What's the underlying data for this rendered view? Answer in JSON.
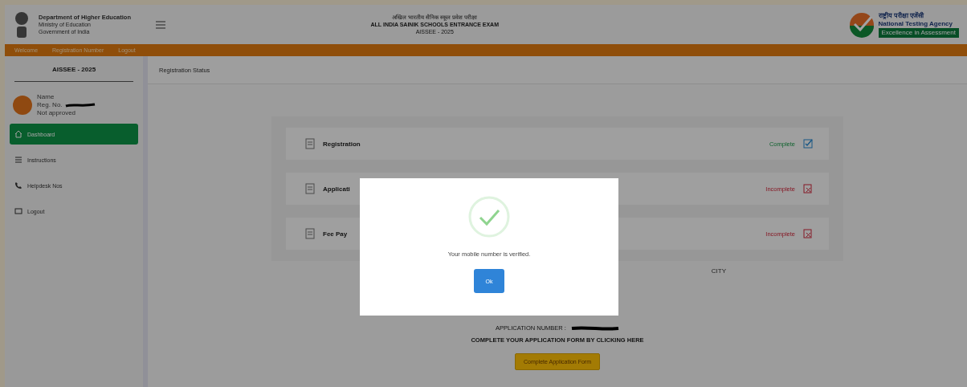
{
  "header": {
    "department": [
      "Department of Higher Education",
      "Ministry of Education",
      "Government of India"
    ],
    "exam_title": [
      "अखिल भारतीय सैनिक स्कूल प्रवेश परीक्षा",
      "ALL INDIA SAINIK SCHOOLS ENTRANCE EXAM",
      "AISSEE - 2025"
    ],
    "agency": {
      "hindi": "राष्ट्रीय परीक्षा एजेंसी",
      "english": "National Testing Agency",
      "tagline": "Excellence in Assessment"
    }
  },
  "nav_bar": [
    "Welcome",
    "Registration Number",
    "Logout"
  ],
  "sidebar": {
    "title": "AISSEE - 2025",
    "user": {
      "name": "Name",
      "reg_label": "Reg. No.",
      "status": "Not approved"
    },
    "items": [
      {
        "label": "Dashboard",
        "selected": true
      },
      {
        "label": "Instructions",
        "selected": false
      },
      {
        "label": "Helpdesk Nos",
        "selected": false
      },
      {
        "label": "Logout",
        "selected": false
      }
    ]
  },
  "main": {
    "title": "Registration Status",
    "steps": [
      {
        "label": "Registration",
        "status": "Complete",
        "complete": true
      },
      {
        "label": "Applicati",
        "status": "Incomplete",
        "complete": false
      },
      {
        "label": "Fee Pay",
        "status": "Incomplete",
        "complete": false
      }
    ],
    "side_note": "CITY",
    "application_number_label": "APPLICATION NUMBER :",
    "instruction": "COMPLETE YOUR APPLICATION FORM BY CLICKING HERE",
    "action_button": "Complete Application Form"
  },
  "modal": {
    "message": "Your mobile number is verified.",
    "button": "Ok"
  }
}
